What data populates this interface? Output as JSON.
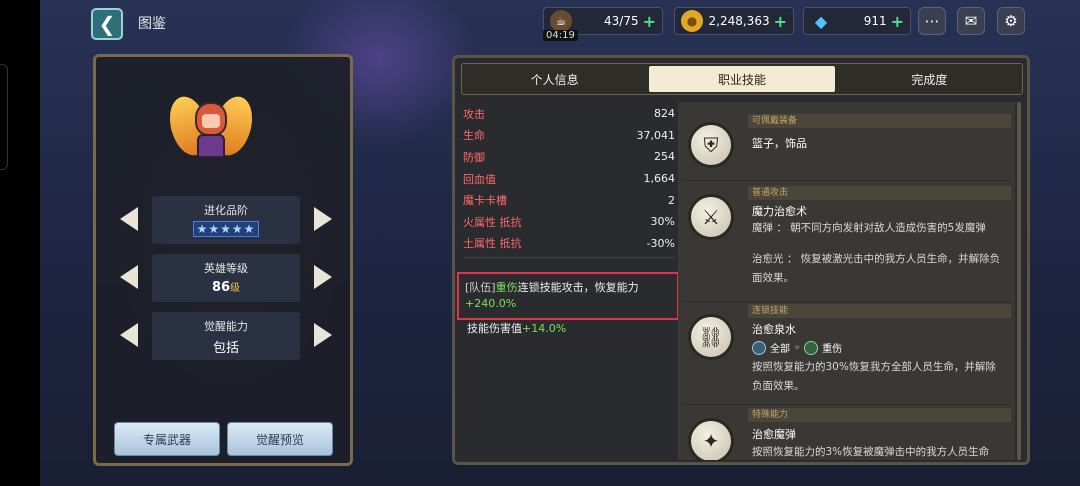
{
  "header": {
    "back_icon": "chevron-left",
    "title": "图鉴",
    "stamina": {
      "icon": "coffee-cup-icon",
      "value": "43/75",
      "timer": "04:19"
    },
    "gold": {
      "icon": "gold-coin-icon",
      "value": "2,248,363"
    },
    "gems": {
      "icon": "diamond-icon",
      "value": "911"
    },
    "plus_symbol": "+",
    "top_icons": [
      "chat-icon",
      "mail-icon",
      "settings-icon"
    ]
  },
  "hero_panel": {
    "evolution": {
      "label": "进化品阶",
      "stars": "★★★★★"
    },
    "level": {
      "label": "英雄等级",
      "value": "86",
      "unit": "级"
    },
    "awakening": {
      "label": "觉醒能力",
      "value": "包括"
    },
    "buttons": {
      "exclusive_weapon": "专属武器",
      "awaken_preview": "觉醒预览"
    }
  },
  "tabs": [
    {
      "label": "个人信息",
      "active": false
    },
    {
      "label": "职业技能",
      "active": true
    },
    {
      "label": "完成度",
      "active": false
    }
  ],
  "stats": [
    {
      "key": "攻击",
      "value": "824"
    },
    {
      "key": "生命",
      "value": "37,041"
    },
    {
      "key": "防御",
      "value": "254"
    },
    {
      "key": "回血值",
      "value": "1,664"
    },
    {
      "key": "魔卡卡槽",
      "value": "2"
    },
    {
      "key": "火属性 抵抗",
      "value": "30%"
    },
    {
      "key": "土属性 抵抗",
      "value": "-30%"
    }
  ],
  "set_effect": {
    "tag": "[队伍]",
    "highlight": "重伤",
    "text": "连锁技能攻击，恢复能力",
    "bonus": "+240.0%"
  },
  "skill_damage": {
    "label": "技能伤害值",
    "bonus": "+14.0%"
  },
  "skills": [
    {
      "category": "可佩戴装备",
      "icon": "shield-sword-icon",
      "name": "篮子，饰品",
      "desc": ""
    },
    {
      "category": "普通攻击",
      "icon": "sword-icon",
      "name": "魔力治愈术",
      "desc": "魔弹 ： 朝不同方向发射对敌人造成伤害的5发魔弹",
      "desc2": "治愈光 ： 恢复被激光击中的我方人员生命，并解除负面效果。"
    },
    {
      "category": "连锁技能",
      "icon": "chain-icon",
      "name": "治愈泉水",
      "chain_from": "全部",
      "chain_to": "重伤",
      "desc": "按照恢复能力的30%恢复我方全部人员生命，并解除负面效果。"
    },
    {
      "category": "特殊能力",
      "icon": "sparkle-icon",
      "name": "治愈魔弹",
      "desc": "按照恢复能力的3%恢复被魔弹击中的我方人员生命"
    }
  ],
  "colors": {
    "accent_green": "#7ee05b",
    "stat_red": "#ff6a6a",
    "highlight_border": "#e0344a"
  }
}
